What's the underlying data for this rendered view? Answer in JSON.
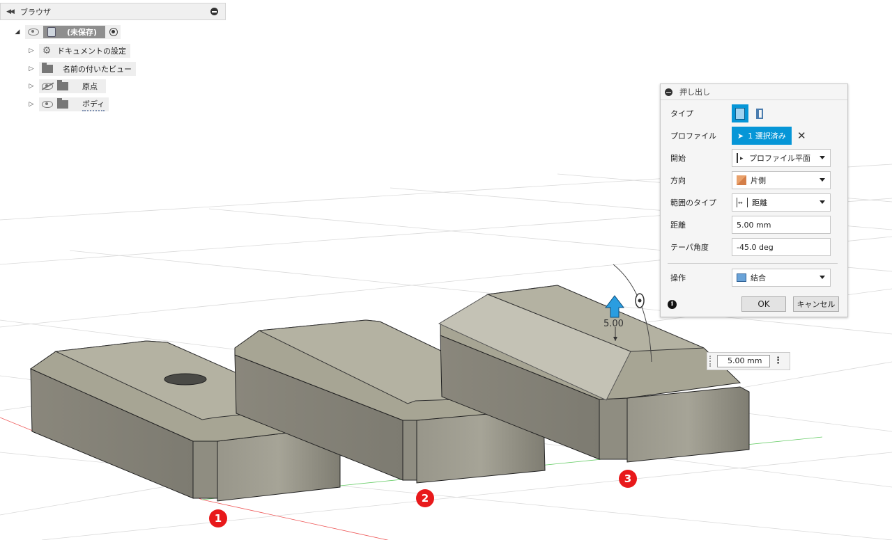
{
  "browser": {
    "title": "ブラウザ",
    "items": [
      {
        "label": "(未保存)"
      },
      {
        "label": "ドキュメントの設定"
      },
      {
        "label": "名前の付いたビュー"
      },
      {
        "label": "原点"
      },
      {
        "label": "ボディ"
      }
    ]
  },
  "dialog": {
    "title": "押し出し",
    "rows": {
      "type": {
        "label": "タイプ"
      },
      "profile": {
        "label": "プロファイル",
        "value": "1 選択済み"
      },
      "start": {
        "label": "開始",
        "value": "プロファイル平面"
      },
      "direction": {
        "label": "方向",
        "value": "片側"
      },
      "extent": {
        "label": "範囲のタイプ",
        "value": "距離"
      },
      "distance": {
        "label": "距離",
        "value": "5.00 mm"
      },
      "taper": {
        "label": "テーパ角度",
        "value": "-45.0 deg"
      },
      "operation": {
        "label": "操作",
        "value": "結合"
      }
    },
    "ok": "OK",
    "cancel": "キャンセル"
  },
  "viewport": {
    "manipulator_label": "5.00",
    "dimension_input": "5.00 mm",
    "badges": [
      "1",
      "2",
      "3"
    ]
  },
  "colors": {
    "accent": "#0696d7",
    "badge": "#e8191b",
    "body": "#a8a595"
  }
}
